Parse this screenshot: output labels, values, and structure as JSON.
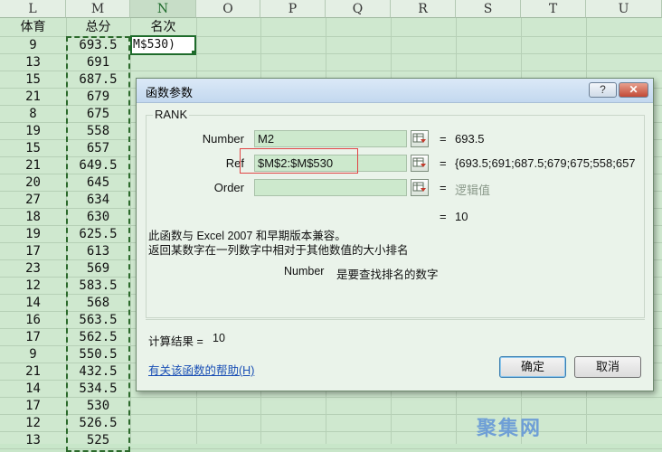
{
  "sheet": {
    "columns": [
      "L",
      "M",
      "N",
      "O",
      "P",
      "Q",
      "R",
      "S",
      "T",
      "U"
    ],
    "headers": {
      "L": "体育",
      "M": "总分",
      "N": "名次"
    },
    "L": [
      "9",
      "13",
      "15",
      "21",
      "8",
      "19",
      "15",
      "21",
      "20",
      "27",
      "18",
      "19",
      "17",
      "23",
      "12",
      "14",
      "16",
      "17",
      "9",
      "21",
      "14",
      "17",
      "12",
      "13"
    ],
    "M": [
      "693.5",
      "691",
      "687.5",
      "679",
      "675",
      "558",
      "657",
      "649.5",
      "645",
      "634",
      "630",
      "625.5",
      "613",
      "569",
      "583.5",
      "568",
      "563.5",
      "562.5",
      "550.5",
      "432.5",
      "534.5",
      "530",
      "526.5",
      "525"
    ],
    "active_cell_text": "M$530)"
  },
  "dialog": {
    "title": "函数参数",
    "help_btn": "?",
    "close_btn": "✕",
    "function_name": "RANK",
    "args": [
      {
        "label": "Number",
        "value": "M2",
        "result": "693.5",
        "hint": false
      },
      {
        "label": "Ref",
        "value": "$M$2:$M$530",
        "result": "{693.5;691;687.5;679;675;558;657;6",
        "hint": false
      },
      {
        "label": "Order",
        "value": "",
        "result": "逻辑值",
        "hint": true
      }
    ],
    "equals": "=",
    "total_result": "10",
    "description1": "此函数与 Excel 2007 和早期版本兼容。",
    "description2": "返回某数字在一列数字中相对于其他数值的大小排名",
    "param_name": "Number",
    "param_desc": "是要查找排名的数字",
    "calc_label": "计算结果 =",
    "calc_value": "10",
    "help_link": "有关该函数的帮助(H)",
    "ok": "确定",
    "cancel": "取消"
  },
  "watermark": "聚集网"
}
